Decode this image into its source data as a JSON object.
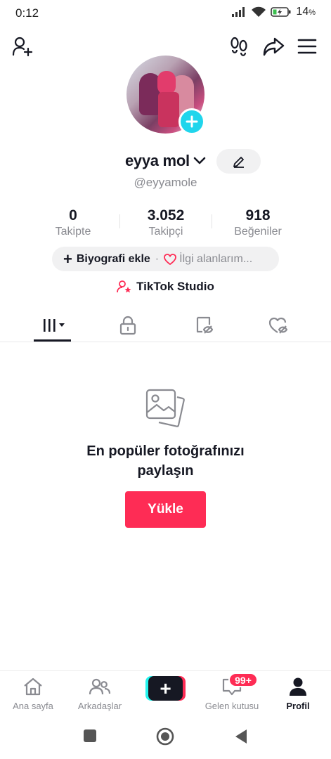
{
  "status_bar": {
    "time": "0:12",
    "battery_percent": "14",
    "battery_unit": "%"
  },
  "profile": {
    "display_name": "eyya mol",
    "username": "@eyyamole",
    "stats": [
      {
        "value": "0",
        "label": "Takipte"
      },
      {
        "value": "3.052",
        "label": "Takipçi"
      },
      {
        "value": "918",
        "label": "Beğeniler"
      }
    ],
    "bio_button": "Biyografi ekle",
    "bio_separator": "·",
    "interests_button": "İlgi alanlarım...",
    "studio_link": "TikTok Studio"
  },
  "empty_state": {
    "title": "En popüler fotoğrafınızı paylaşın",
    "upload_button": "Yükle"
  },
  "bottom_nav": {
    "items": [
      {
        "label": "Ana sayfa"
      },
      {
        "label": "Arkadaşlar"
      },
      {
        "label": "Gelen kutusu"
      },
      {
        "label": "Profil"
      }
    ],
    "create_symbol": "+",
    "inbox_badge": "99+"
  },
  "colors": {
    "accent": "#fe2c55",
    "cyan": "#25f4ee",
    "text_primary": "#161823",
    "text_secondary": "#8a8b91"
  }
}
